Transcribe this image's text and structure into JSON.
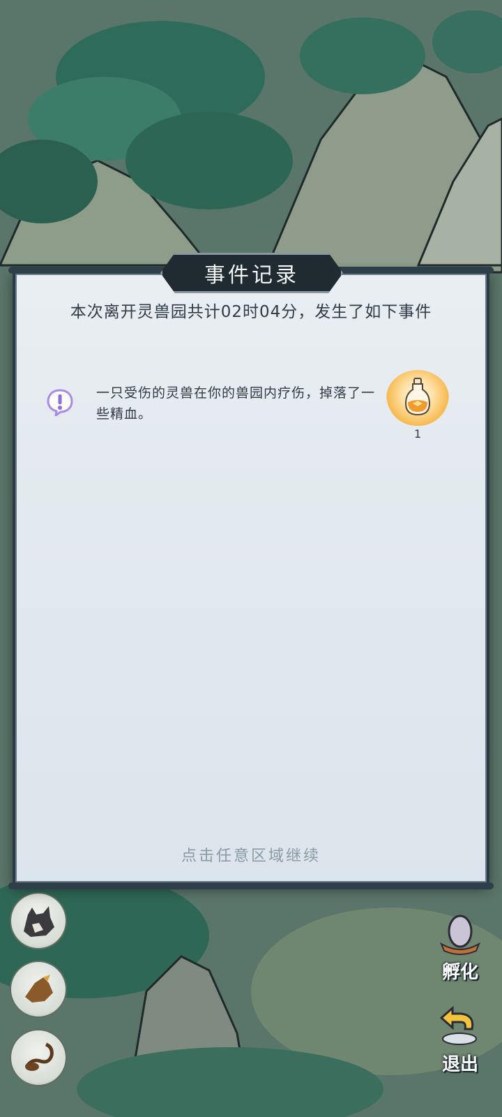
{
  "modal": {
    "title": "事件记录",
    "summary": "本次离开灵兽园共计02时04分，发生了如下事件",
    "events": [
      {
        "text": "一只受伤的灵兽在你的兽园内疗伤，掉落了一些精血。",
        "reward_icon": "elixir-bottle-icon",
        "reward_count": "1"
      }
    ],
    "continue_hint": "点击任意区域继续"
  },
  "right_actions": {
    "hatch_label": "孵化",
    "exit_label": "退出"
  },
  "colors": {
    "modal_bg": "#e2e9ee",
    "title_plate": "#1f2a31",
    "text": "#2f3b45",
    "hint": "#8a9aa6",
    "alert_icon": "#a88be8"
  }
}
